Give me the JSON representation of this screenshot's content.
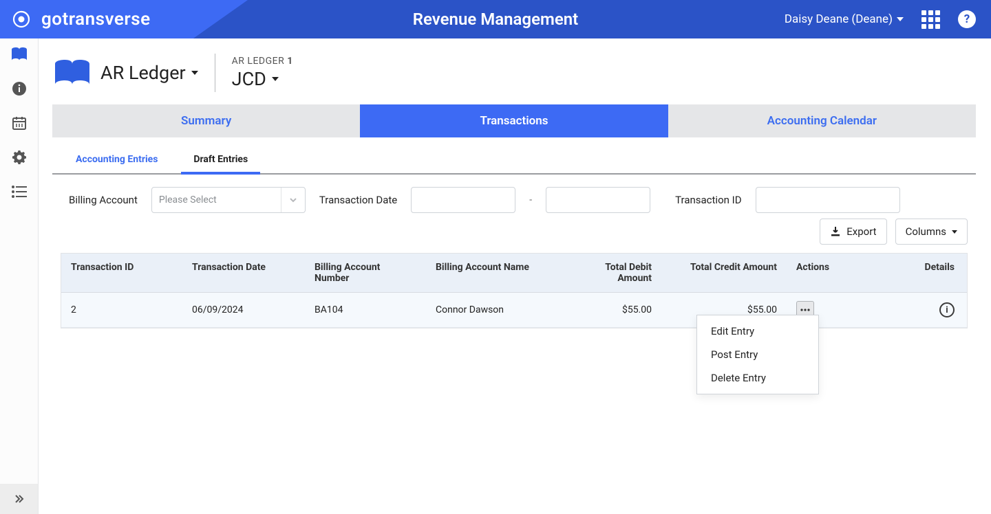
{
  "brand": "gotransverse",
  "app_title": "Revenue Management",
  "user_name": "Daisy Deane (Deane)",
  "breadcrumb": {
    "section": "AR Ledger",
    "sub_label_prefix": "AR LEDGER",
    "sub_label_number": "1",
    "sub_value": "JCD"
  },
  "primary_tabs": [
    "Summary",
    "Transactions",
    "Accounting Calendar"
  ],
  "primary_tab_active_index": 1,
  "sub_tabs": [
    "Accounting Entries",
    "Draft Entries"
  ],
  "sub_tab_active_index": 1,
  "filters": {
    "billing_account_label": "Billing Account",
    "billing_account_placeholder": "Please Select",
    "tx_date_label": "Transaction Date",
    "tx_id_label": "Transaction ID"
  },
  "toolbar": {
    "export_label": "Export",
    "columns_label": "Columns"
  },
  "columns": {
    "transaction_id": "Transaction ID",
    "transaction_date": "Transaction Date",
    "billing_account_number": "Billing Account Number",
    "billing_account_name": "Billing Account Name",
    "total_debit": "Total Debit Amount",
    "total_credit": "Total Credit Amount",
    "actions": "Actions",
    "details": "Details"
  },
  "rows": [
    {
      "transaction_id": "2",
      "transaction_date": "06/09/2024",
      "billing_account_number": "BA104",
      "billing_account_name": "Connor Dawson",
      "total_debit": "$55.00",
      "total_credit": "$55.00"
    }
  ],
  "actions_menu": [
    "Edit Entry",
    "Post Entry",
    "Delete Entry"
  ]
}
